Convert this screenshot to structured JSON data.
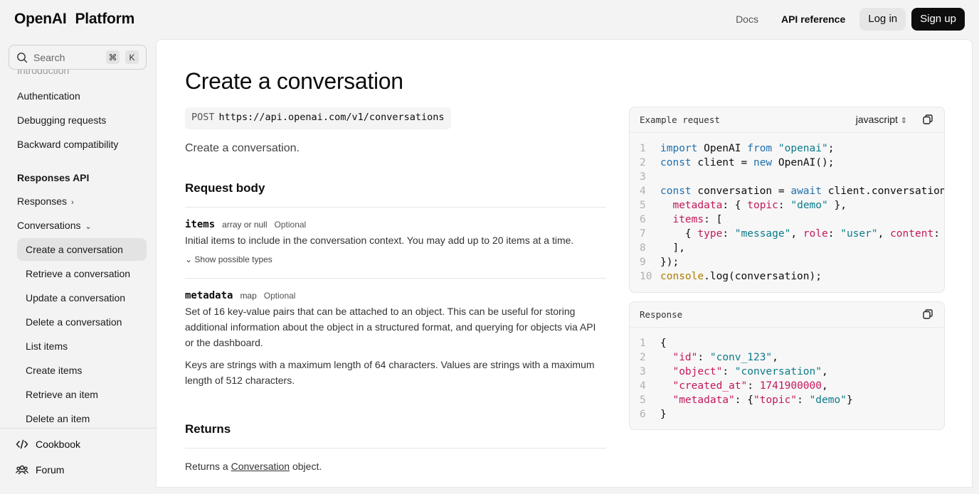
{
  "header": {
    "logo_openai": "OpenAI",
    "logo_platform": "Platform",
    "docs": "Docs",
    "api_reference": "API reference",
    "login": "Log in",
    "signup": "Sign up"
  },
  "search": {
    "placeholder": "Search",
    "key1": "⌘",
    "key2": "K"
  },
  "sidebar": {
    "items": [
      "Introduction",
      "Authentication",
      "Debugging requests",
      "Backward compatibility",
      "Responses API",
      "Responses",
      "Conversations",
      "Create a conversation",
      "Retrieve a conversation",
      "Update a conversation",
      "Delete a conversation",
      "List items",
      "Create items",
      "Retrieve an item",
      "Delete an item"
    ],
    "footer": [
      "Cookbook",
      "Forum"
    ]
  },
  "main": {
    "title": "Create a conversation",
    "method": "POST",
    "url": "https://api.openai.com/v1/conversations",
    "description": "Create a conversation.",
    "request_body_heading": "Request body",
    "params": [
      {
        "name": "items",
        "type": "array or null",
        "optional": "Optional",
        "desc": "Initial items to include in the conversation context. You may add up to 20 items at a time.",
        "show_types": "Show possible types"
      },
      {
        "name": "metadata",
        "type": "map",
        "optional": "Optional",
        "desc1": "Set of 16 key-value pairs that can be attached to an object. This can be useful for storing additional information about the object in a structured format, and querying for objects via API or the dashboard.",
        "desc2": "Keys are strings with a maximum length of 64 characters. Values are strings with a maximum length of 512 characters."
      }
    ],
    "returns_heading": "Returns",
    "returns_pre": "Returns a ",
    "returns_link": "Conversation",
    "returns_post": " object."
  },
  "example": {
    "label": "Example request",
    "language": "javascript"
  },
  "response": {
    "label": "Response"
  }
}
